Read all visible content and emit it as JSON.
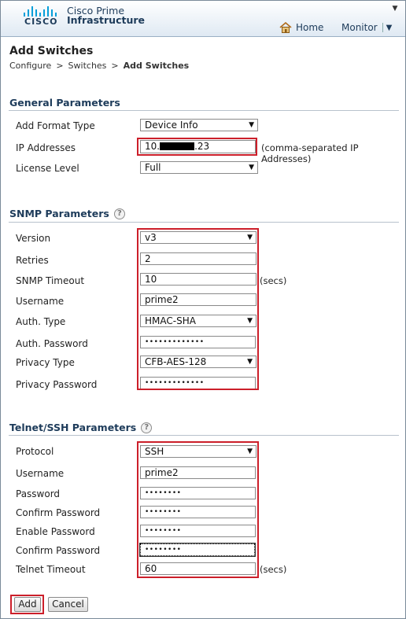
{
  "header": {
    "brand_line1": "Cisco Prime",
    "brand_line2": "Infrastructure",
    "logo_text": "CISCO",
    "home_label": "Home",
    "monitor_label": "Monitor",
    "window_control": "▼"
  },
  "page": {
    "title": "Add Switches",
    "breadcrumb": [
      "Configure",
      ">",
      "Switches",
      ">",
      "Add Switches"
    ]
  },
  "general": {
    "title": "General Parameters",
    "add_format_type": {
      "label": "Add Format Type",
      "value": "Device Info"
    },
    "ip_addresses": {
      "label": "IP Addresses",
      "value_prefix": "10.",
      "value_suffix": ".23",
      "hint": "(comma-separated IP Addresses)"
    },
    "license_level": {
      "label": "License Level",
      "value": "Full"
    }
  },
  "snmp": {
    "title": "SNMP Parameters",
    "version": {
      "label": "Version",
      "value": "v3"
    },
    "retries": {
      "label": "Retries",
      "value": "2"
    },
    "timeout": {
      "label": "SNMP Timeout",
      "value": "10",
      "unit": "(secs)"
    },
    "username": {
      "label": "Username",
      "value": "prime2"
    },
    "auth_type": {
      "label": "Auth. Type",
      "value": "HMAC-SHA"
    },
    "auth_password": {
      "label": "Auth. Password",
      "value": "•••••••••••••"
    },
    "privacy_type": {
      "label": "Privacy Type",
      "value": "CFB-AES-128"
    },
    "privacy_password": {
      "label": "Privacy Password",
      "value": "•••••••••••••"
    }
  },
  "telnet": {
    "title": "Telnet/SSH Parameters",
    "protocol": {
      "label": "Protocol",
      "value": "SSH"
    },
    "username": {
      "label": "Username",
      "value": "prime2"
    },
    "password": {
      "label": "Password",
      "value": "••••••••"
    },
    "confirm_password": {
      "label": "Confirm Password",
      "value": "••••••••"
    },
    "enable_password": {
      "label": "Enable Password",
      "value": "••••••••"
    },
    "confirm_enable_password": {
      "label": "Confirm Password",
      "value": "••••••••"
    },
    "timeout": {
      "label": "Telnet Timeout",
      "value": "60",
      "unit": "(secs)"
    }
  },
  "actions": {
    "add": "Add",
    "cancel": "Cancel"
  },
  "colors": {
    "highlight": "#cc1f2a",
    "brand": "#1d3b5a",
    "logo_bars": "#049fd9"
  },
  "icons": {
    "home": "home-icon",
    "help": "help-icon",
    "dropdown": "chevron-down-icon"
  }
}
